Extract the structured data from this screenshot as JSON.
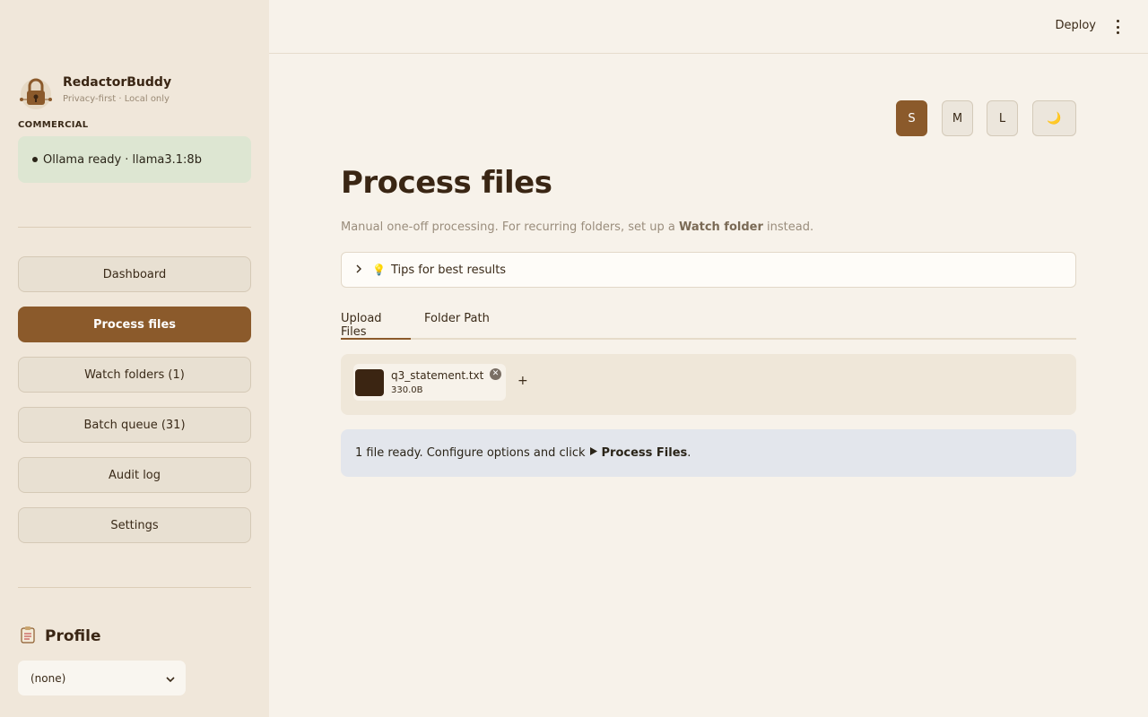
{
  "app": {
    "name": "RedactorBuddy",
    "tagline": "Privacy-first · Local only",
    "tier": "COMMERCIAL",
    "status": "Ollama ready · llama3.1:8b"
  },
  "nav": {
    "items": [
      {
        "label": "Dashboard"
      },
      {
        "label": "Process files"
      },
      {
        "label": "Watch folders (1)"
      },
      {
        "label": "Batch queue (31)"
      },
      {
        "label": "Audit log"
      },
      {
        "label": "Settings"
      }
    ],
    "active": "Process files"
  },
  "profile": {
    "icon": "clipboard-icon",
    "title": "Profile",
    "selected": "(none)"
  },
  "topbar": {
    "deploy_label": "Deploy",
    "menu_icon": "kebab-menu-icon"
  },
  "size_buttons": {
    "s": "S",
    "m": "M",
    "l": "L",
    "dark": "🌙",
    "active": "S"
  },
  "main": {
    "title": "Process files",
    "caption_pre": "Manual one-off processing. For recurring folders, set up a ",
    "caption_link": "Watch folder",
    "caption_post": " instead.",
    "tips_label": "Tips for best results",
    "tabs": [
      {
        "label": "Upload Files"
      },
      {
        "label": "Folder Path"
      }
    ],
    "active_tab": "Upload Files",
    "file": {
      "name": "q3_statement.txt",
      "size": "330.0B"
    },
    "add_label": "+",
    "info_pre": "1 file ready. Configure options and click ",
    "info_action": "Process Files",
    "info_post": "."
  },
  "colors": {
    "accent": "#8b5a2b",
    "sidebar_bg": "#f0e7da",
    "page_bg": "#f7f2ea",
    "status_bg": "#dde6d2",
    "info_bg": "#e3e6ec"
  }
}
